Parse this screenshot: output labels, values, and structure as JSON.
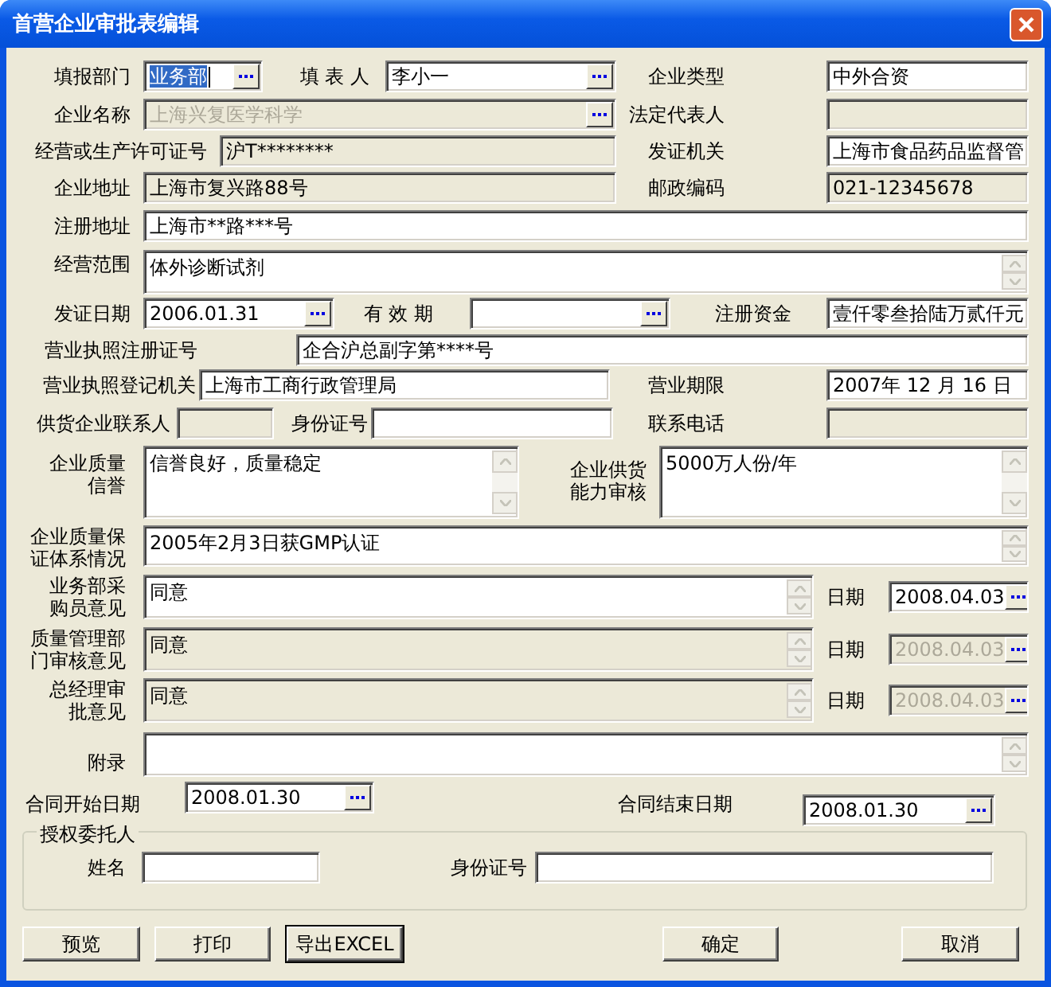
{
  "window": {
    "title": "首营企业审批表编辑"
  },
  "rows": [
    {
      "fields": [
        {
          "label": "填报部门",
          "kind": "picker",
          "value": "业务部",
          "focused": true,
          "readonly": false,
          "disabled": false
        },
        {
          "label": "填 表 人",
          "kind": "picker",
          "value": "李小一",
          "focused": false,
          "readonly": false,
          "disabled": false
        },
        {
          "label": "企业类型",
          "kind": "text",
          "value": "中外合资",
          "focused": false,
          "readonly": false,
          "disabled": false
        }
      ]
    },
    {
      "fields": [
        {
          "label": "企业名称",
          "kind": "picker",
          "value": "上海兴复医学科学",
          "focused": false,
          "readonly": false,
          "disabled": true
        },
        {
          "label": "法定代表人",
          "kind": "text",
          "focused": false,
          "readonly": true,
          "disabled": false
        }
      ]
    },
    {
      "fields": [
        {
          "label": "经营或生产许可证号",
          "kind": "text",
          "value": "沪T********",
          "focused": false,
          "readonly": true,
          "disabled": false
        },
        {
          "label": "发证机关",
          "kind": "text",
          "value": "上海市食品药品监督管",
          "focused": false,
          "readonly": false,
          "disabled": false
        }
      ]
    },
    {
      "fields": [
        {
          "label": "企业地址",
          "kind": "text",
          "value": "上海市复兴路88号",
          "focused": false,
          "readonly": true,
          "disabled": false
        },
        {
          "label": "邮政编码",
          "kind": "text",
          "value": "021-12345678",
          "focused": false,
          "readonly": true,
          "disabled": false
        }
      ]
    },
    {
      "fields": [
        {
          "label": "注册地址",
          "kind": "text",
          "value": "上海市**路***号",
          "focused": false,
          "readonly": false,
          "disabled": false
        }
      ]
    },
    {
      "fields": [
        {
          "label": "经营范围",
          "kind": "memo",
          "value": "体外诊断试剂",
          "focused": false,
          "readonly": false,
          "disabled": false
        }
      ]
    },
    {
      "fields": [
        {
          "label": "发证日期",
          "kind": "picker",
          "value": "2006.01.31",
          "focused": false,
          "readonly": false,
          "disabled": false
        },
        {
          "label": "有 效 期",
          "kind": "picker",
          "focused": false,
          "readonly": false,
          "disabled": false
        },
        {
          "label": "注册资金",
          "kind": "text",
          "value": "壹仟零叁拾陆万贰仟元",
          "focused": false,
          "readonly": false,
          "disabled": false
        }
      ]
    },
    {
      "fields": [
        {
          "label": "营业执照注册证号",
          "kind": "text",
          "value": "企合沪总副字第****号",
          "focused": false,
          "readonly": false,
          "disabled": false
        }
      ]
    },
    {
      "fields": [
        {
          "label": "营业执照登记机关",
          "kind": "text",
          "value": "上海市工商行政管理局",
          "focused": false,
          "readonly": false,
          "disabled": false
        },
        {
          "label": "营业期限",
          "kind": "text",
          "value": "2007年 12 月 16 日",
          "focused": false,
          "readonly": false,
          "disabled": false
        }
      ]
    },
    {
      "fields": [
        {
          "label": "供货企业联系人",
          "kind": "text",
          "focused": false,
          "readonly": true,
          "disabled": false
        },
        {
          "label": "身份证号",
          "kind": "text",
          "focused": false,
          "readonly": false,
          "disabled": false
        },
        {
          "label": "联系电话",
          "kind": "text",
          "focused": false,
          "readonly": true,
          "disabled": false
        }
      ]
    },
    {
      "fields": [
        {
          "label": "企业质量信誉",
          "kind": "memo",
          "value": "信誉良好，质量稳定",
          "focused": false,
          "readonly": false,
          "disabled": false
        },
        {
          "label": "企业供货能力审核",
          "kind": "memo",
          "value": "5000万人份/年",
          "focused": false,
          "readonly": false,
          "disabled": false
        }
      ]
    },
    {
      "fields": [
        {
          "label": "企业质量保证体系情况",
          "kind": "memo",
          "value": "2005年2月3日获GMP认证",
          "focused": false,
          "readonly": false,
          "disabled": false
        }
      ]
    },
    {
      "fields": [
        {
          "label": "业务部采购员意见",
          "kind": "memo",
          "value": "同意",
          "focused": false,
          "readonly": false,
          "disabled": false
        },
        {
          "label": "日期",
          "kind": "picker",
          "value": "2008.04.03",
          "focused": false,
          "readonly": false,
          "disabled": false
        }
      ]
    },
    {
      "fields": [
        {
          "label": "质量管理部门审核意见",
          "kind": "memo",
          "value": "同意",
          "focused": false,
          "readonly": true,
          "disabled": false
        },
        {
          "label": "日期",
          "kind": "picker",
          "value": "2008.04.03",
          "focused": false,
          "readonly": false,
          "disabled": true
        }
      ]
    },
    {
      "fields": [
        {
          "label": "总经理审批意见",
          "kind": "memo",
          "value": "同意",
          "focused": false,
          "readonly": true,
          "disabled": false
        },
        {
          "label": "日期",
          "kind": "picker",
          "value": "2008.04.03",
          "focused": false,
          "readonly": false,
          "disabled": true
        }
      ]
    },
    {
      "fields": [
        {
          "label": "附录",
          "kind": "memo",
          "focused": false,
          "readonly": false,
          "disabled": false
        }
      ]
    },
    {
      "fields": [
        {
          "label": "合同开始日期",
          "kind": "picker",
          "value": "2008.01.30",
          "focused": false,
          "readonly": false,
          "disabled": false
        },
        {
          "label": "合同结束日期",
          "kind": "picker",
          "value": "2008.01.30",
          "focused": false,
          "readonly": false,
          "disabled": false
        }
      ]
    }
  ],
  "group": {
    "title": "授权委托人",
    "fields": [
      {
        "label": "姓名",
        "kind": "text",
        "focused": false,
        "readonly": false,
        "disabled": false
      },
      {
        "label": "身份证号",
        "kind": "text",
        "focused": false,
        "readonly": false,
        "disabled": false
      }
    ]
  },
  "buttons": [
    {
      "label": "预览",
      "default": false
    },
    {
      "label": "打印",
      "default": false
    },
    {
      "label": "导出EXCEL",
      "default": true
    },
    {
      "label": "确定",
      "default": false
    },
    {
      "label": "取消",
      "default": false
    }
  ]
}
